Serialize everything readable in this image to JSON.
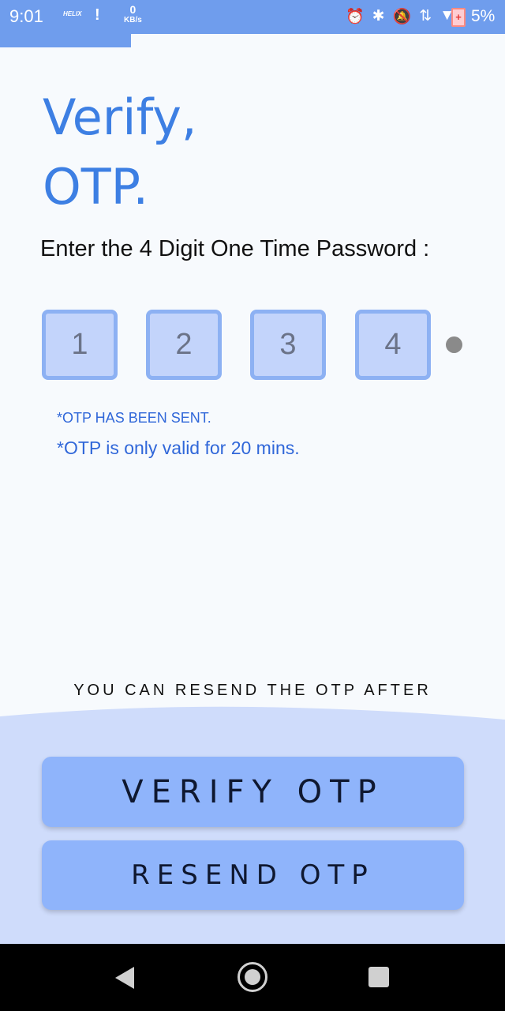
{
  "status_bar": {
    "time": "9:01",
    "carrier_logo": "HELIX",
    "alert_icon": "!",
    "net_speed_value": "0",
    "net_speed_unit": "KB/s",
    "icons": [
      "alarm-icon",
      "bluetooth-icon",
      "notifications-off-icon",
      "data-arrows-icon",
      "wifi-icon"
    ],
    "icon_glyphs": [
      "⏰",
      "✱",
      "🔕",
      "⇅",
      "▼"
    ],
    "battery_icon": "+",
    "battery": "5%"
  },
  "progress": {
    "value": 0.26
  },
  "title_line1": "Verify,",
  "title_line2": "OTP.",
  "prompt": "Enter the 4 Digit One Time Password :",
  "otp": {
    "digits": [
      "1",
      "2",
      "3",
      "4"
    ]
  },
  "notes": {
    "sent": "*OTP HAS BEEN SENT.",
    "validity": "*OTP is only valid for 20 mins."
  },
  "resend_after": "YOU CAN RESEND THE OTP AFTER",
  "buttons": {
    "verify": "VERIFY OTP",
    "resend": "RESEND OTP"
  },
  "colors": {
    "accent": "#3d7fe3",
    "status_bar": "#6f9ded",
    "button": "#8fb4fb",
    "bottom_panel": "#cfdcfb",
    "otp_box": "#c3d4fb"
  }
}
